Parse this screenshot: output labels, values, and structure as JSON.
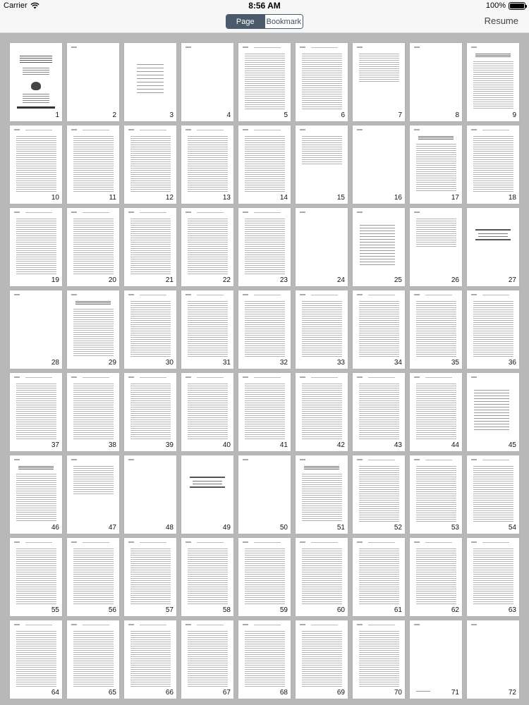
{
  "status_bar": {
    "carrier": "Carrier",
    "time": "8:56 AM",
    "battery": "100%"
  },
  "nav": {
    "segments": [
      {
        "label": "Page",
        "active": true
      },
      {
        "label": "Bookmark",
        "active": false
      }
    ],
    "resume_label": "Resume"
  },
  "pages": [
    {
      "num": "1",
      "layout": "cover"
    },
    {
      "num": "2",
      "layout": "blank"
    },
    {
      "num": "3",
      "layout": "center"
    },
    {
      "num": "4",
      "layout": "blank"
    },
    {
      "num": "5",
      "layout": "text"
    },
    {
      "num": "6",
      "layout": "text"
    },
    {
      "num": "7",
      "layout": "short"
    },
    {
      "num": "8",
      "layout": "blank"
    },
    {
      "num": "9",
      "layout": "heading"
    },
    {
      "num": "10",
      "layout": "text"
    },
    {
      "num": "11",
      "layout": "text"
    },
    {
      "num": "12",
      "layout": "text"
    },
    {
      "num": "13",
      "layout": "text"
    },
    {
      "num": "14",
      "layout": "text"
    },
    {
      "num": "15",
      "layout": "short"
    },
    {
      "num": "16",
      "layout": "blank"
    },
    {
      "num": "17",
      "layout": "heading"
    },
    {
      "num": "18",
      "layout": "text"
    },
    {
      "num": "19",
      "layout": "text"
    },
    {
      "num": "20",
      "layout": "text"
    },
    {
      "num": "21",
      "layout": "text"
    },
    {
      "num": "22",
      "layout": "text"
    },
    {
      "num": "23",
      "layout": "text"
    },
    {
      "num": "24",
      "layout": "blank"
    },
    {
      "num": "25",
      "layout": "toc"
    },
    {
      "num": "26",
      "layout": "short"
    },
    {
      "num": "27",
      "layout": "title"
    },
    {
      "num": "28",
      "layout": "blank"
    },
    {
      "num": "29",
      "layout": "heading"
    },
    {
      "num": "30",
      "layout": "text"
    },
    {
      "num": "31",
      "layout": "text"
    },
    {
      "num": "32",
      "layout": "text"
    },
    {
      "num": "33",
      "layout": "text"
    },
    {
      "num": "34",
      "layout": "text"
    },
    {
      "num": "35",
      "layout": "text"
    },
    {
      "num": "36",
      "layout": "text"
    },
    {
      "num": "37",
      "layout": "text"
    },
    {
      "num": "38",
      "layout": "text"
    },
    {
      "num": "39",
      "layout": "text"
    },
    {
      "num": "40",
      "layout": "text"
    },
    {
      "num": "41",
      "layout": "text"
    },
    {
      "num": "42",
      "layout": "text"
    },
    {
      "num": "43",
      "layout": "text"
    },
    {
      "num": "44",
      "layout": "text"
    },
    {
      "num": "45",
      "layout": "toc"
    },
    {
      "num": "46",
      "layout": "heading"
    },
    {
      "num": "47",
      "layout": "short"
    },
    {
      "num": "48",
      "layout": "blank"
    },
    {
      "num": "49",
      "layout": "title"
    },
    {
      "num": "50",
      "layout": "blank"
    },
    {
      "num": "51",
      "layout": "heading"
    },
    {
      "num": "52",
      "layout": "text"
    },
    {
      "num": "53",
      "layout": "text"
    },
    {
      "num": "54",
      "layout": "text"
    },
    {
      "num": "55",
      "layout": "text"
    },
    {
      "num": "56",
      "layout": "text"
    },
    {
      "num": "57",
      "layout": "text"
    },
    {
      "num": "58",
      "layout": "text"
    },
    {
      "num": "59",
      "layout": "text"
    },
    {
      "num": "60",
      "layout": "text"
    },
    {
      "num": "61",
      "layout": "text"
    },
    {
      "num": "62",
      "layout": "text"
    },
    {
      "num": "63",
      "layout": "text"
    },
    {
      "num": "64",
      "layout": "text"
    },
    {
      "num": "65",
      "layout": "text"
    },
    {
      "num": "66",
      "layout": "text"
    },
    {
      "num": "67",
      "layout": "text"
    },
    {
      "num": "68",
      "layout": "text"
    },
    {
      "num": "69",
      "layout": "text"
    },
    {
      "num": "70",
      "layout": "text"
    },
    {
      "num": "71",
      "layout": "footnote"
    },
    {
      "num": "72",
      "layout": "blank"
    }
  ]
}
